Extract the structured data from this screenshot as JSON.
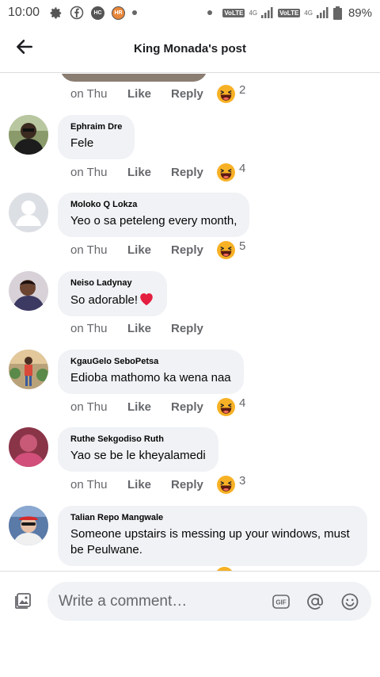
{
  "status_bar": {
    "time": "10:00",
    "left_icons": [
      "gear-icon",
      "facebook-icon",
      "hc-icon",
      "hr-icon",
      "dot-icon"
    ],
    "hc_label": "HC",
    "hr_label": "HR",
    "volte_label": "VoLTE",
    "network_label": "4G",
    "battery_percent": "89%"
  },
  "header": {
    "title": "King Monada's post",
    "back_icon": "back-arrow-icon"
  },
  "colors": {
    "bubble": "#f0f2f5",
    "secondary_text": "#65676b",
    "divider": "#dcdcdc",
    "haha_emoji": "#f7b125",
    "heart": "#e41e3f"
  },
  "top_actions": {
    "time": "on Thu",
    "like": "Like",
    "reply": "Reply",
    "reaction_icon": "haha-emoji-icon",
    "reaction_count": "2"
  },
  "comments": [
    {
      "author": "Ephraim Dre",
      "text": "Fele",
      "time": "on Thu",
      "like": "Like",
      "reply": "Reply",
      "reaction_count": "4"
    },
    {
      "author": "Moloko Q Lokza",
      "text": "Yeo o sa peteleng every month,",
      "time": "on Thu",
      "like": "Like",
      "reply": "Reply",
      "reaction_count": "5"
    },
    {
      "author": "Neiso Ladynay",
      "text": "So adorable!",
      "text_emoji": "heart-icon",
      "time": "on Thu",
      "like": "Like",
      "reply": "Reply",
      "reaction_count": ""
    },
    {
      "author": "KgauGelo SeboPetsa",
      "text": "Edioba mathomo ka wena naa",
      "time": "on Thu",
      "like": "Like",
      "reply": "Reply",
      "reaction_count": "4"
    },
    {
      "author": "Ruthe Sekgodiso Ruth",
      "text": "Yao se be le kheyalamedi",
      "time": "on Thu",
      "like": "Like",
      "reply": "Reply",
      "reaction_count": "3"
    },
    {
      "author": "Talian Repo Mangwale",
      "text": "Someone upstairs is messing up your windows, must be Peulwane.",
      "time": "",
      "like": "",
      "reply": "",
      "reaction_count": ""
    }
  ],
  "composer": {
    "placeholder": "Write a comment…",
    "photo_icon": "photo-icon",
    "gif_label": "GIF",
    "mention_icon": "at-icon",
    "emoji_icon": "smiley-icon"
  }
}
